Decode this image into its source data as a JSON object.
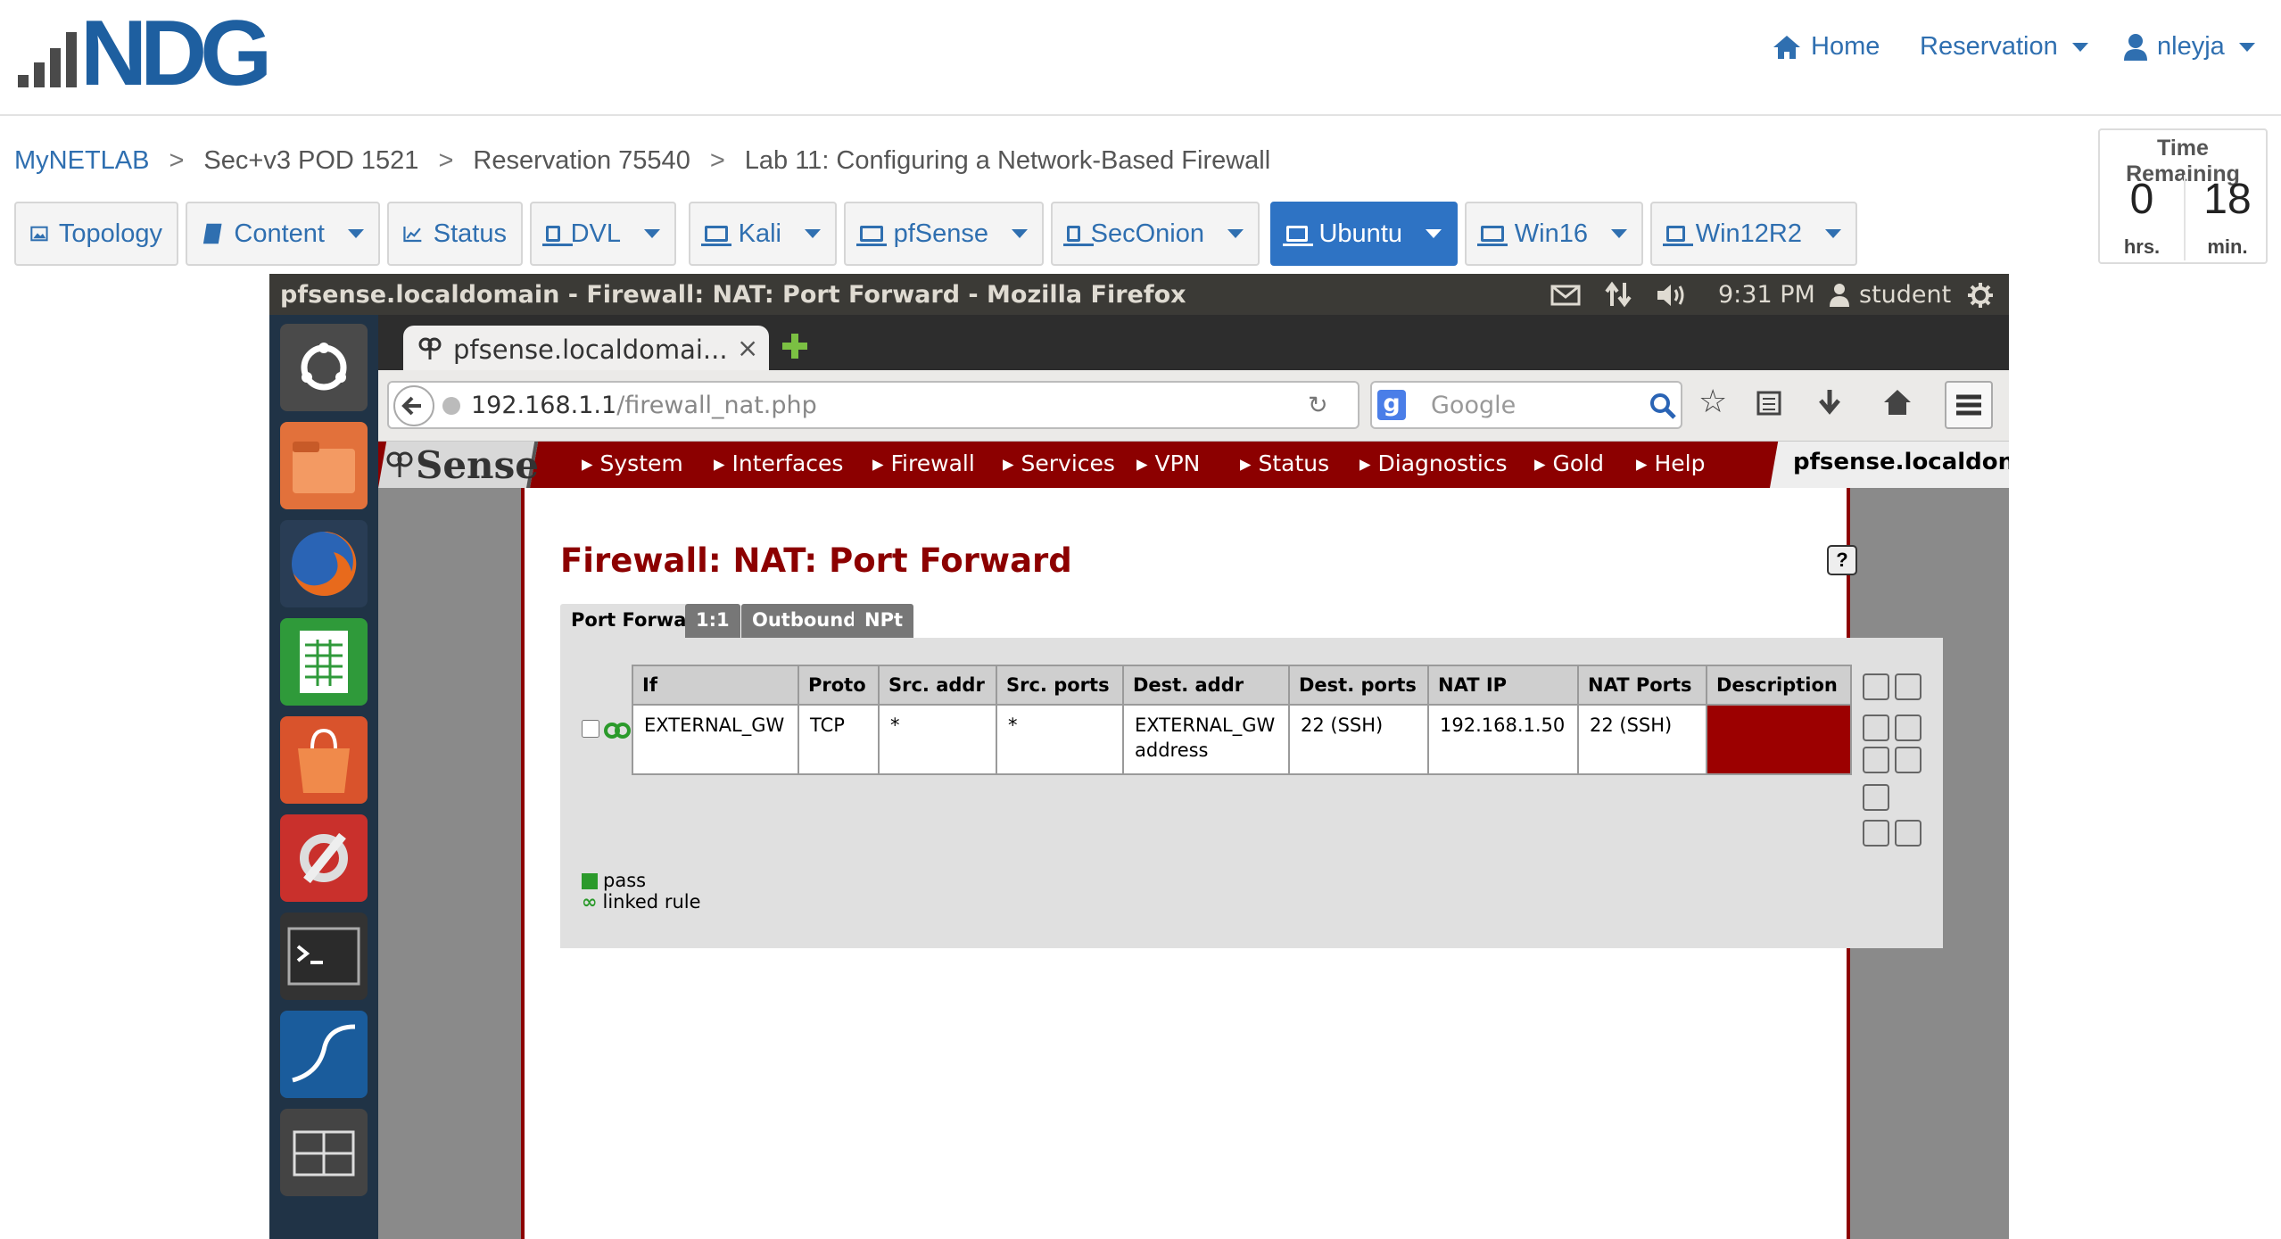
{
  "portal": {
    "logo_text": "NDG",
    "nav": {
      "home": "Home",
      "reservation": "Reservation",
      "user": "nleyja"
    },
    "breadcrumb": [
      "MyNETLAB",
      "Sec+v3 POD 1521",
      "Reservation 75540",
      "Lab 11: Configuring a Network-Based Firewall"
    ],
    "toolbar": {
      "topology": "Topology",
      "content": "Content",
      "status": "Status",
      "machines": [
        "DVL",
        "Kali",
        "pfSense",
        "SecOnion",
        "Ubuntu",
        "Win16",
        "Win12R2"
      ],
      "active_machine": "Ubuntu"
    },
    "time_remaining": {
      "title": "Time Remaining",
      "hours": "0",
      "hours_unit": "hrs.",
      "minutes": "18",
      "minutes_unit": "min."
    }
  },
  "desktop": {
    "window_title": "pfsense.localdomain - Firewall: NAT: Port Forward - Mozilla Firefox",
    "clock": "9:31 PM",
    "user": "student",
    "browser": {
      "tab_title": "pfsense.localdomai...",
      "url_host": "192.168.1.1",
      "url_path": "/firewall_nat.php",
      "search_placeholder": "Google"
    },
    "pfsense": {
      "logo": "Sense",
      "menu": [
        "System",
        "Interfaces",
        "Firewall",
        "Services",
        "VPN",
        "Status",
        "Diagnostics",
        "Gold",
        "Help"
      ],
      "hostname": "pfsense.localdon",
      "page_title": "Firewall: NAT: Port Forward",
      "help_icon": "?",
      "tabs": [
        "Port Forward",
        "1:1",
        "Outbound",
        "NPt"
      ],
      "table": {
        "headers": [
          "If",
          "Proto",
          "Src. addr",
          "Src. ports",
          "Dest. addr",
          "Dest. ports",
          "NAT IP",
          "NAT Ports",
          "Description"
        ],
        "row": {
          "if": "EXTERNAL_GW",
          "proto": "TCP",
          "src_addr": "*",
          "src_ports": "*",
          "dest_addr_1": "EXTERNAL_GW",
          "dest_addr_2": "address",
          "dest_ports": "22 (SSH)",
          "nat_ip": "192.168.1.50",
          "nat_ports": "22 (SSH)",
          "description": ""
        }
      },
      "legend": {
        "pass": "pass",
        "linked": "linked rule"
      }
    }
  },
  "colors": {
    "brand_blue": "#2f6fb0",
    "active_tab": "#2e73c4",
    "pfsense_red": "#8c0000"
  }
}
